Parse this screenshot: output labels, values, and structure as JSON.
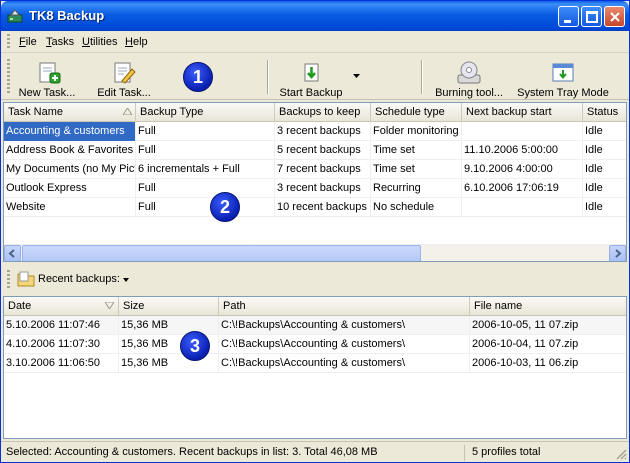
{
  "window": {
    "title": "TK8 Backup"
  },
  "menu": [
    {
      "key": "F",
      "rest": "ile"
    },
    {
      "key": "T",
      "rest": "asks"
    },
    {
      "key": "U",
      "rest": "tilities"
    },
    {
      "key": "H",
      "rest": "elp"
    }
  ],
  "toolbar": {
    "new_task": "New Task...",
    "edit_task": "Edit Task...",
    "start_backup": "Start Backup",
    "burning_tool": "Burning tool...",
    "tray_mode": "System Tray Mode"
  },
  "callouts": [
    "1",
    "2",
    "3"
  ],
  "tasks": {
    "columns": [
      "Task Name",
      "Backup Type",
      "Backups to keep",
      "Schedule type",
      "Next backup start",
      "Status"
    ],
    "rows": [
      [
        "Accounting & customers",
        "Full",
        "3 recent backups",
        "Folder monitoring",
        "",
        "Idle"
      ],
      [
        "Address Book & Favorites",
        "Full",
        "5 recent backups",
        "Time set",
        "11.10.2006 5:00:00",
        "Idle"
      ],
      [
        "My Documents (no My Pictures)",
        "6 incrementals + Full",
        "7 recent backups",
        "Time set",
        "9.10.2006 4:00:00",
        "Idle"
      ],
      [
        "Outlook Express",
        "Full",
        "3 recent backups",
        "Recurring",
        "6.10.2006 17:06:19",
        "Idle"
      ],
      [
        "Website",
        "Full",
        "10 recent backups",
        "No schedule",
        "",
        "Idle"
      ]
    ]
  },
  "recent": {
    "label": "Recent backups:",
    "columns": [
      "Date",
      "Size",
      "Path",
      "File name"
    ],
    "rows": [
      [
        "5.10.2006 11:07:46",
        "15,36 MB",
        "C:\\!Backups\\Accounting & customers\\",
        "2006-10-05, 11 07.zip"
      ],
      [
        "4.10.2006 11:07:30",
        "15,36 MB",
        "C:\\!Backups\\Accounting & customers\\",
        "2006-10-04, 11 07.zip"
      ],
      [
        "3.10.2006 11:06:50",
        "15,36 MB",
        "C:\\!Backups\\Accounting & customers\\",
        "2006-10-03, 11 06.zip"
      ]
    ]
  },
  "status": {
    "left": "Selected: Accounting & customers.   Recent backups in list: 3.   Total 46,08 MB",
    "right": "5 profiles total"
  }
}
